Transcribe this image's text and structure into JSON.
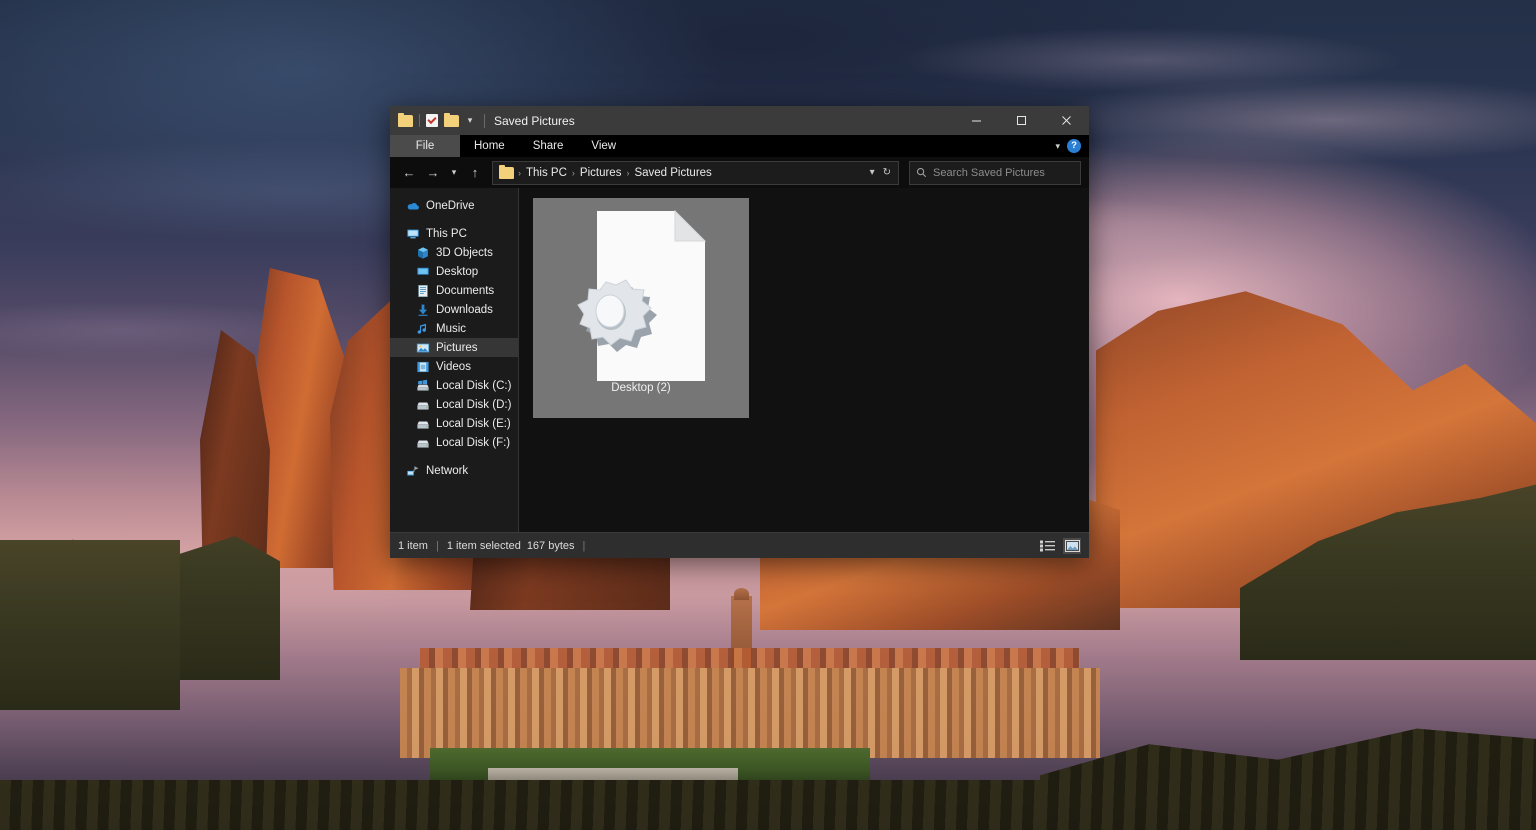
{
  "desktop": {
    "wallpaper_description": "Sunset photo of red sandstone rock formations (Mallos de Riglos) above a Spanish hillside village, with purple-pink cloudy sky",
    "colors": {
      "sky_top": "#233048",
      "sky_glow": "#d2a0a3",
      "rock": "#c06232",
      "vegetation": "#3a3622"
    }
  },
  "window": {
    "title": "Saved Pictures",
    "quick_access": [
      {
        "name": "folder-icon",
        "label": "Saved Pictures folder"
      },
      {
        "name": "properties-icon",
        "label": "Properties"
      },
      {
        "name": "new-folder-icon",
        "label": "New folder"
      },
      {
        "name": "chevron-down-icon",
        "label": "Customize Quick Access Toolbar"
      }
    ],
    "controls": {
      "minimize": "Minimize",
      "maximize": "Maximize",
      "close": "Close"
    },
    "ribbon": {
      "tabs": [
        {
          "label": "File",
          "active": true
        },
        {
          "label": "Home",
          "active": false
        },
        {
          "label": "Share",
          "active": false
        },
        {
          "label": "View",
          "active": false
        }
      ],
      "expand_label": "Expand the Ribbon",
      "help_label": "?"
    },
    "address": {
      "back": "Back",
      "forward": "Forward",
      "recent": "Recent locations",
      "up": "Up",
      "breadcrumbs": [
        "This PC",
        "Pictures",
        "Saved Pictures"
      ],
      "separator": "›",
      "dropdown": "Previous locations",
      "refresh": "Refresh"
    },
    "search": {
      "placeholder": "Search Saved Pictures",
      "icon": "search-icon"
    },
    "navigation_pane": [
      {
        "label": "OneDrive",
        "icon": "onedrive-cloud-icon",
        "indent": false,
        "selected": false
      },
      {
        "label": "This PC",
        "icon": "this-pc-monitor-icon",
        "indent": false,
        "selected": false,
        "gap_before": true
      },
      {
        "label": "3D Objects",
        "icon": "3d-objects-cube-icon",
        "indent": true,
        "selected": false
      },
      {
        "label": "Desktop",
        "icon": "desktop-monitor-icon",
        "indent": true,
        "selected": false
      },
      {
        "label": "Documents",
        "icon": "documents-icon",
        "indent": true,
        "selected": false
      },
      {
        "label": "Downloads",
        "icon": "downloads-arrow-icon",
        "indent": true,
        "selected": false
      },
      {
        "label": "Music",
        "icon": "music-note-icon",
        "indent": true,
        "selected": false
      },
      {
        "label": "Pictures",
        "icon": "pictures-icon",
        "indent": true,
        "selected": true
      },
      {
        "label": "Videos",
        "icon": "videos-icon",
        "indent": true,
        "selected": false
      },
      {
        "label": "Local Disk (C:)",
        "icon": "system-drive-icon",
        "indent": true,
        "selected": false
      },
      {
        "label": "Local Disk (D:)",
        "icon": "drive-icon",
        "indent": true,
        "selected": false
      },
      {
        "label": "Local Disk (E:)",
        "icon": "drive-icon",
        "indent": true,
        "selected": false
      },
      {
        "label": "Local Disk (F:)",
        "icon": "drive-icon",
        "indent": true,
        "selected": false
      },
      {
        "label": "Network",
        "icon": "network-icon",
        "indent": false,
        "selected": false,
        "gap_before": true
      }
    ],
    "files": [
      {
        "name": "Desktop (2)",
        "icon": "configuration-settings-file-icon",
        "selected": true
      }
    ],
    "status": {
      "item_count": "1 item",
      "selection": "1 item selected",
      "size": "167 bytes",
      "views": [
        {
          "name": "details-view-button",
          "active": false
        },
        {
          "name": "large-icons-view-button",
          "active": true
        }
      ]
    }
  }
}
